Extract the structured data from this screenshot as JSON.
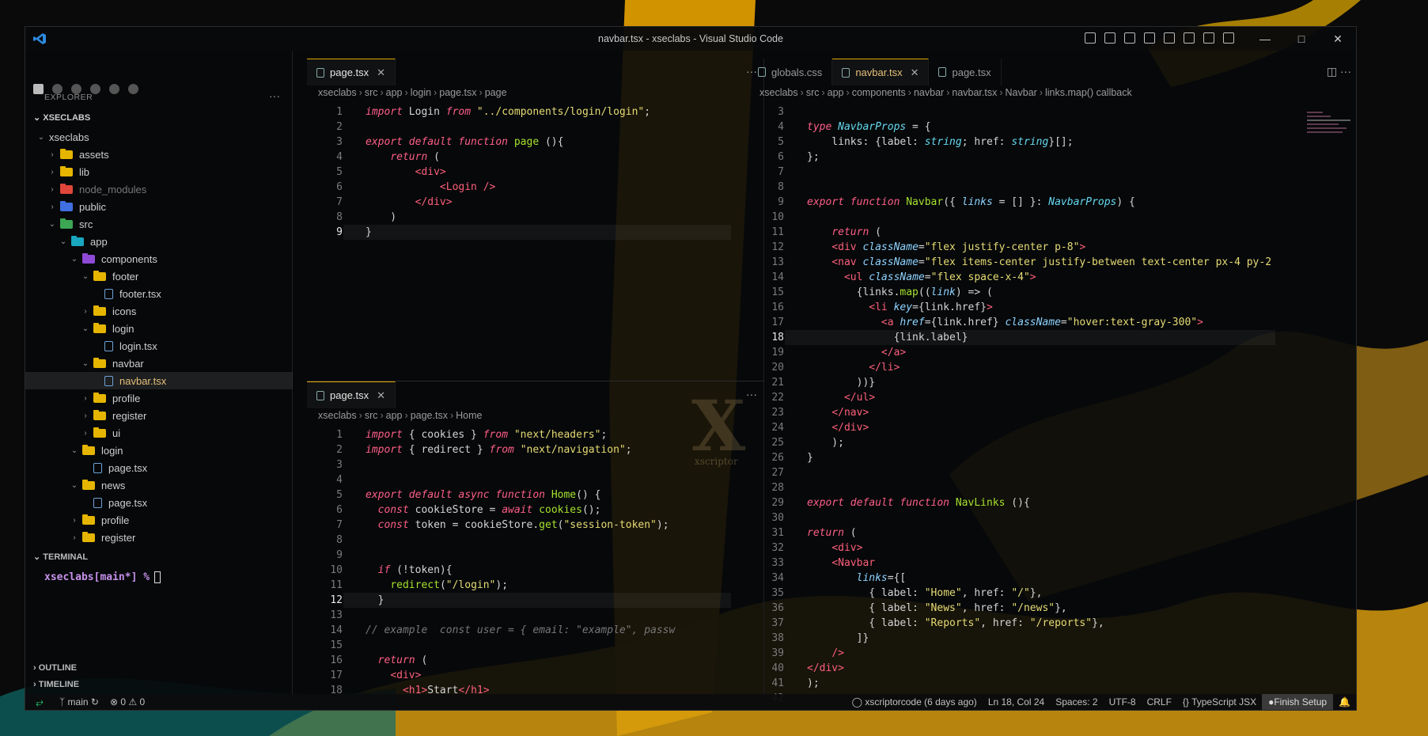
{
  "window": {
    "title": "navbar.tsx - xseclabs - Visual Studio Code"
  },
  "sidebar": {
    "explorer_label": "EXPLORER",
    "root_label": "XSECLABS",
    "tree": [
      {
        "label": "xseclabs",
        "depth": 1,
        "kind": "root-open"
      },
      {
        "label": "assets",
        "depth": 2,
        "kind": "folder",
        "color": "#e5b500"
      },
      {
        "label": "lib",
        "depth": 2,
        "kind": "folder",
        "color": "#e5b500"
      },
      {
        "label": "node_modules",
        "depth": 2,
        "kind": "folder",
        "color": "#e0463a",
        "dim": true
      },
      {
        "label": "public",
        "depth": 2,
        "kind": "folder",
        "color": "#3f6fe0"
      },
      {
        "label": "src",
        "depth": 2,
        "kind": "folder-open",
        "color": "#3ca653"
      },
      {
        "label": "app",
        "depth": 3,
        "kind": "folder-open",
        "color": "#19a7c0"
      },
      {
        "label": "components",
        "depth": 4,
        "kind": "folder-open",
        "color": "#8e4ad6"
      },
      {
        "label": "footer",
        "depth": 5,
        "kind": "folder-open",
        "color": "#e5b500"
      },
      {
        "label": "footer.tsx",
        "depth": 6,
        "kind": "file"
      },
      {
        "label": "icons",
        "depth": 5,
        "kind": "folder",
        "color": "#e5b500"
      },
      {
        "label": "login",
        "depth": 5,
        "kind": "folder-open",
        "color": "#e5b500"
      },
      {
        "label": "login.tsx",
        "depth": 6,
        "kind": "file"
      },
      {
        "label": "navbar",
        "depth": 5,
        "kind": "folder-open",
        "color": "#e5b500"
      },
      {
        "label": "navbar.tsx",
        "depth": 6,
        "kind": "file",
        "active": true
      },
      {
        "label": "profile",
        "depth": 5,
        "kind": "folder",
        "color": "#e5b500"
      },
      {
        "label": "register",
        "depth": 5,
        "kind": "folder",
        "color": "#e5b500"
      },
      {
        "label": "ui",
        "depth": 5,
        "kind": "folder",
        "color": "#e5b500"
      },
      {
        "label": "login",
        "depth": 4,
        "kind": "folder-open",
        "color": "#e5b500"
      },
      {
        "label": "page.tsx",
        "depth": 5,
        "kind": "file"
      },
      {
        "label": "news",
        "depth": 4,
        "kind": "folder-open",
        "color": "#e5b500"
      },
      {
        "label": "page.tsx",
        "depth": 5,
        "kind": "file"
      },
      {
        "label": "profile",
        "depth": 4,
        "kind": "folder",
        "color": "#e5b500"
      },
      {
        "label": "register",
        "depth": 4,
        "kind": "folder",
        "color": "#e5b500"
      }
    ],
    "terminal_label": "TERMINAL",
    "terminal_prompt": "xseclabs[main*] %",
    "outline_label": "OUTLINE",
    "timeline_label": "TIMELINE"
  },
  "editor_top_left": {
    "tab": "page.tsx",
    "crumbs": [
      "xseclabs",
      "src",
      "app",
      "login",
      "page.tsx",
      "page"
    ],
    "current_line": 9,
    "lines": [
      "<span class='kw'>import</span> Login <span class='kw'>from</span> <span class='str'>\"../components/login/login\"</span>;",
      "",
      "<span class='kw'>export default function</span> <span class='fn'>page</span> (){",
      "    <span class='kw'>return</span> (",
      "        <span class='tag'>&lt;div&gt;</span>",
      "            <span class='tag'>&lt;Login /&gt;</span>",
      "        <span class='tag'>&lt;/div&gt;</span>",
      "    )",
      "}"
    ]
  },
  "editor_bottom_left": {
    "tab": "page.tsx",
    "crumbs": [
      "xseclabs",
      "src",
      "app",
      "page.tsx",
      "Home"
    ],
    "current_line": 12,
    "lines": [
      "<span class='kw'>import</span> { cookies } <span class='kw'>from</span> <span class='str'>\"next/headers\"</span>;",
      "<span class='kw'>import</span> { redirect } <span class='kw'>from</span> <span class='str'>\"next/navigation\"</span>;",
      "",
      "",
      "<span class='kw'>export default async function</span> <span class='fn'>Home</span>() {",
      "  <span class='kw'>const</span> cookieStore = <span class='kw'>await</span> <span class='fn'>cookies</span>();",
      "  <span class='kw'>const</span> token = cookieStore.<span class='fn'>get</span>(<span class='str'>\"session-token\"</span>);",
      "",
      "",
      "  <span class='kw'>if</span> (!token){",
      "    <span class='fn'>redirect</span>(<span class='str'>\"/login\"</span>);",
      "  }",
      "",
      "<span class='cm'>// example  const user = { email: \"example\", passw</span>",
      "",
      "  <span class='kw'>return</span> (",
      "    <span class='tag'>&lt;div&gt;</span>",
      "      <span class='tag'>&lt;h1&gt;</span>Start<span class='tag'>&lt;/h1&gt;</span>"
    ]
  },
  "editor_right": {
    "tabs": [
      {
        "label": "globals.css",
        "active": false
      },
      {
        "label": "navbar.tsx",
        "active": true
      },
      {
        "label": "page.tsx",
        "active": false
      }
    ],
    "crumbs": [
      "xseclabs",
      "src",
      "app",
      "components",
      "navbar",
      "navbar.tsx",
      "Navbar",
      "links.map() callback"
    ],
    "first_line": 3,
    "current_line": 18,
    "lines": [
      "",
      "<span class='kw'>type</span> <span class='ty'>NavbarProps</span> = {",
      "    links: {label: <span class='ty'>string</span>; href: <span class='ty'>string</span>}[];",
      "};",
      "",
      "",
      "<span class='kw'>export function</span> <span class='fn'>Navbar</span>({ <span class='attr'>links</span> = [] }: <span class='ty'>NavbarProps</span>) {",
      "",
      "    <span class='kw'>return</span> (",
      "    <span class='tag'>&lt;div</span> <span class='attr'>className</span>=<span class='str'>\"flex justify-center p-8\"</span><span class='tag'>&gt;</span>",
      "    <span class='tag'>&lt;nav</span> <span class='attr'>className</span>=<span class='str'>\"flex items-center justify-between text-center px-4 py-2</span>",
      "      <span class='tag'>&lt;ul</span> <span class='attr'>className</span>=<span class='str'>\"flex space-x-4\"</span><span class='tag'>&gt;</span>",
      "        {links.<span class='fn'>map</span>((<span class='attr'>link</span>) =&gt; (",
      "          <span class='tag'>&lt;li</span> <span class='attr'>key</span>={link.href}<span class='tag'>&gt;</span>",
      "            <span class='tag'>&lt;a</span> <span class='attr'>href</span>={link.href} <span class='attr'>className</span>=<span class='str'>\"hover:text-gray-300\"</span><span class='tag'>&gt;</span>",
      "              {link.label}",
      "            <span class='tag'>&lt;/a&gt;</span>",
      "          <span class='tag'>&lt;/li&gt;</span>",
      "        ))}",
      "      <span class='tag'>&lt;/ul&gt;</span>",
      "    <span class='tag'>&lt;/nav&gt;</span>",
      "    <span class='tag'>&lt;/div&gt;</span>",
      "    );",
      "}",
      "",
      "",
      "<span class='kw'>export default function</span> <span class='fn'>NavLinks</span> (){",
      "",
      "<span class='kw'>return</span> (",
      "    <span class='tag'>&lt;div&gt;</span>",
      "    <span class='tag'>&lt;Navbar</span>",
      "        <span class='attr'>links</span>={[",
      "          { label: <span class='str'>\"Home\"</span>, href: <span class='str'>\"/\"</span>},",
      "          { label: <span class='str'>\"News\"</span>, href: <span class='str'>\"/news\"</span>},",
      "          { label: <span class='str'>\"Reports\"</span>, href: <span class='str'>\"/reports\"</span>},",
      "        ]}",
      "    <span class='tag'>/&gt;</span>",
      "<span class='tag'>&lt;/div&gt;</span>",
      ");",
      ""
    ]
  },
  "watermark": {
    "letter": "X",
    "caption": "xscriptor"
  },
  "statusbar": {
    "branch": "main",
    "errors": "0",
    "warnings": "0",
    "blame": "xscriptorcode (6 days ago)",
    "position": "Ln 18, Col 24",
    "spaces": "Spaces: 2",
    "encoding": "UTF-8",
    "eol": "CRLF",
    "language": "TypeScript JSX",
    "finish_setup": "Finish Setup"
  },
  "colors": {
    "accent": "#e5a400",
    "remote": "#26e07f"
  }
}
